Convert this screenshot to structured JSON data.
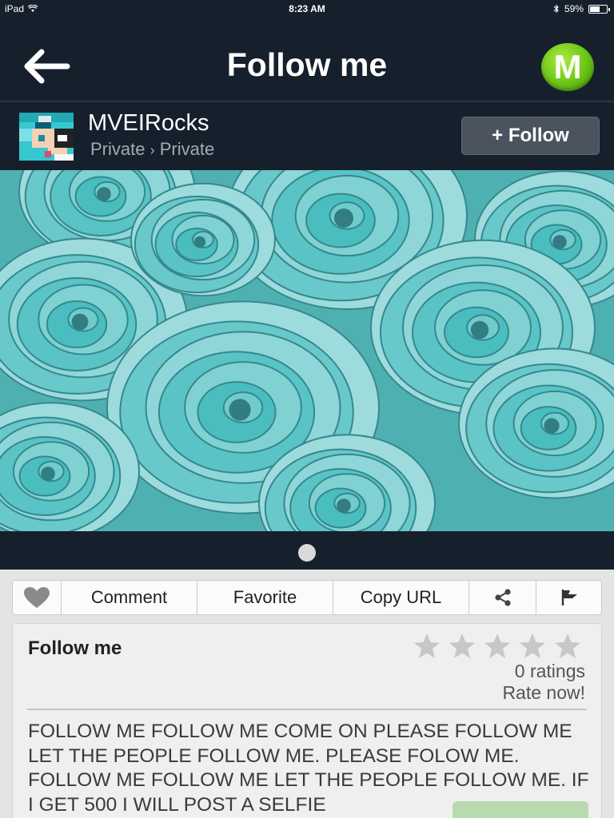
{
  "status_bar": {
    "device": "iPad",
    "time": "8:23 AM",
    "battery_text": "59%",
    "battery_level": 0.59
  },
  "nav": {
    "title": "Follow me",
    "back_icon": "arrow-left-icon",
    "logo_letter": "M",
    "logo_color": "#6bc417"
  },
  "profile": {
    "username": "MVEIRocks",
    "breadcrumb": [
      "Private",
      "Private"
    ],
    "breadcrumb_separator": "›",
    "follow_label": "+ Follow"
  },
  "hero": {
    "pager_count": 1,
    "pager_active": 1,
    "accent_color": "#5dbcbc"
  },
  "actions": {
    "like_icon": "heart-icon",
    "comment_label": "Comment",
    "favorite_label": "Favorite",
    "copy_url_label": "Copy URL",
    "share_icon": "share-icon",
    "report_icon": "flag-icon"
  },
  "post": {
    "title": "Follow me",
    "rating_stars": 0,
    "rating_max": 5,
    "ratings_count_text": "0 ratings",
    "rate_now_label": "Rate now!",
    "description": "FOLLOW ME FOLLOW ME COME ON PLEASE FOLLOW ME LET THE PEOPLE FOLLOW ME. PLEASE FOLOW ME. FOLLOW ME FOLLOW ME LET THE PEOPLE FOLLOW ME. IF I GET 500 I WILL POST A SELFIE"
  }
}
